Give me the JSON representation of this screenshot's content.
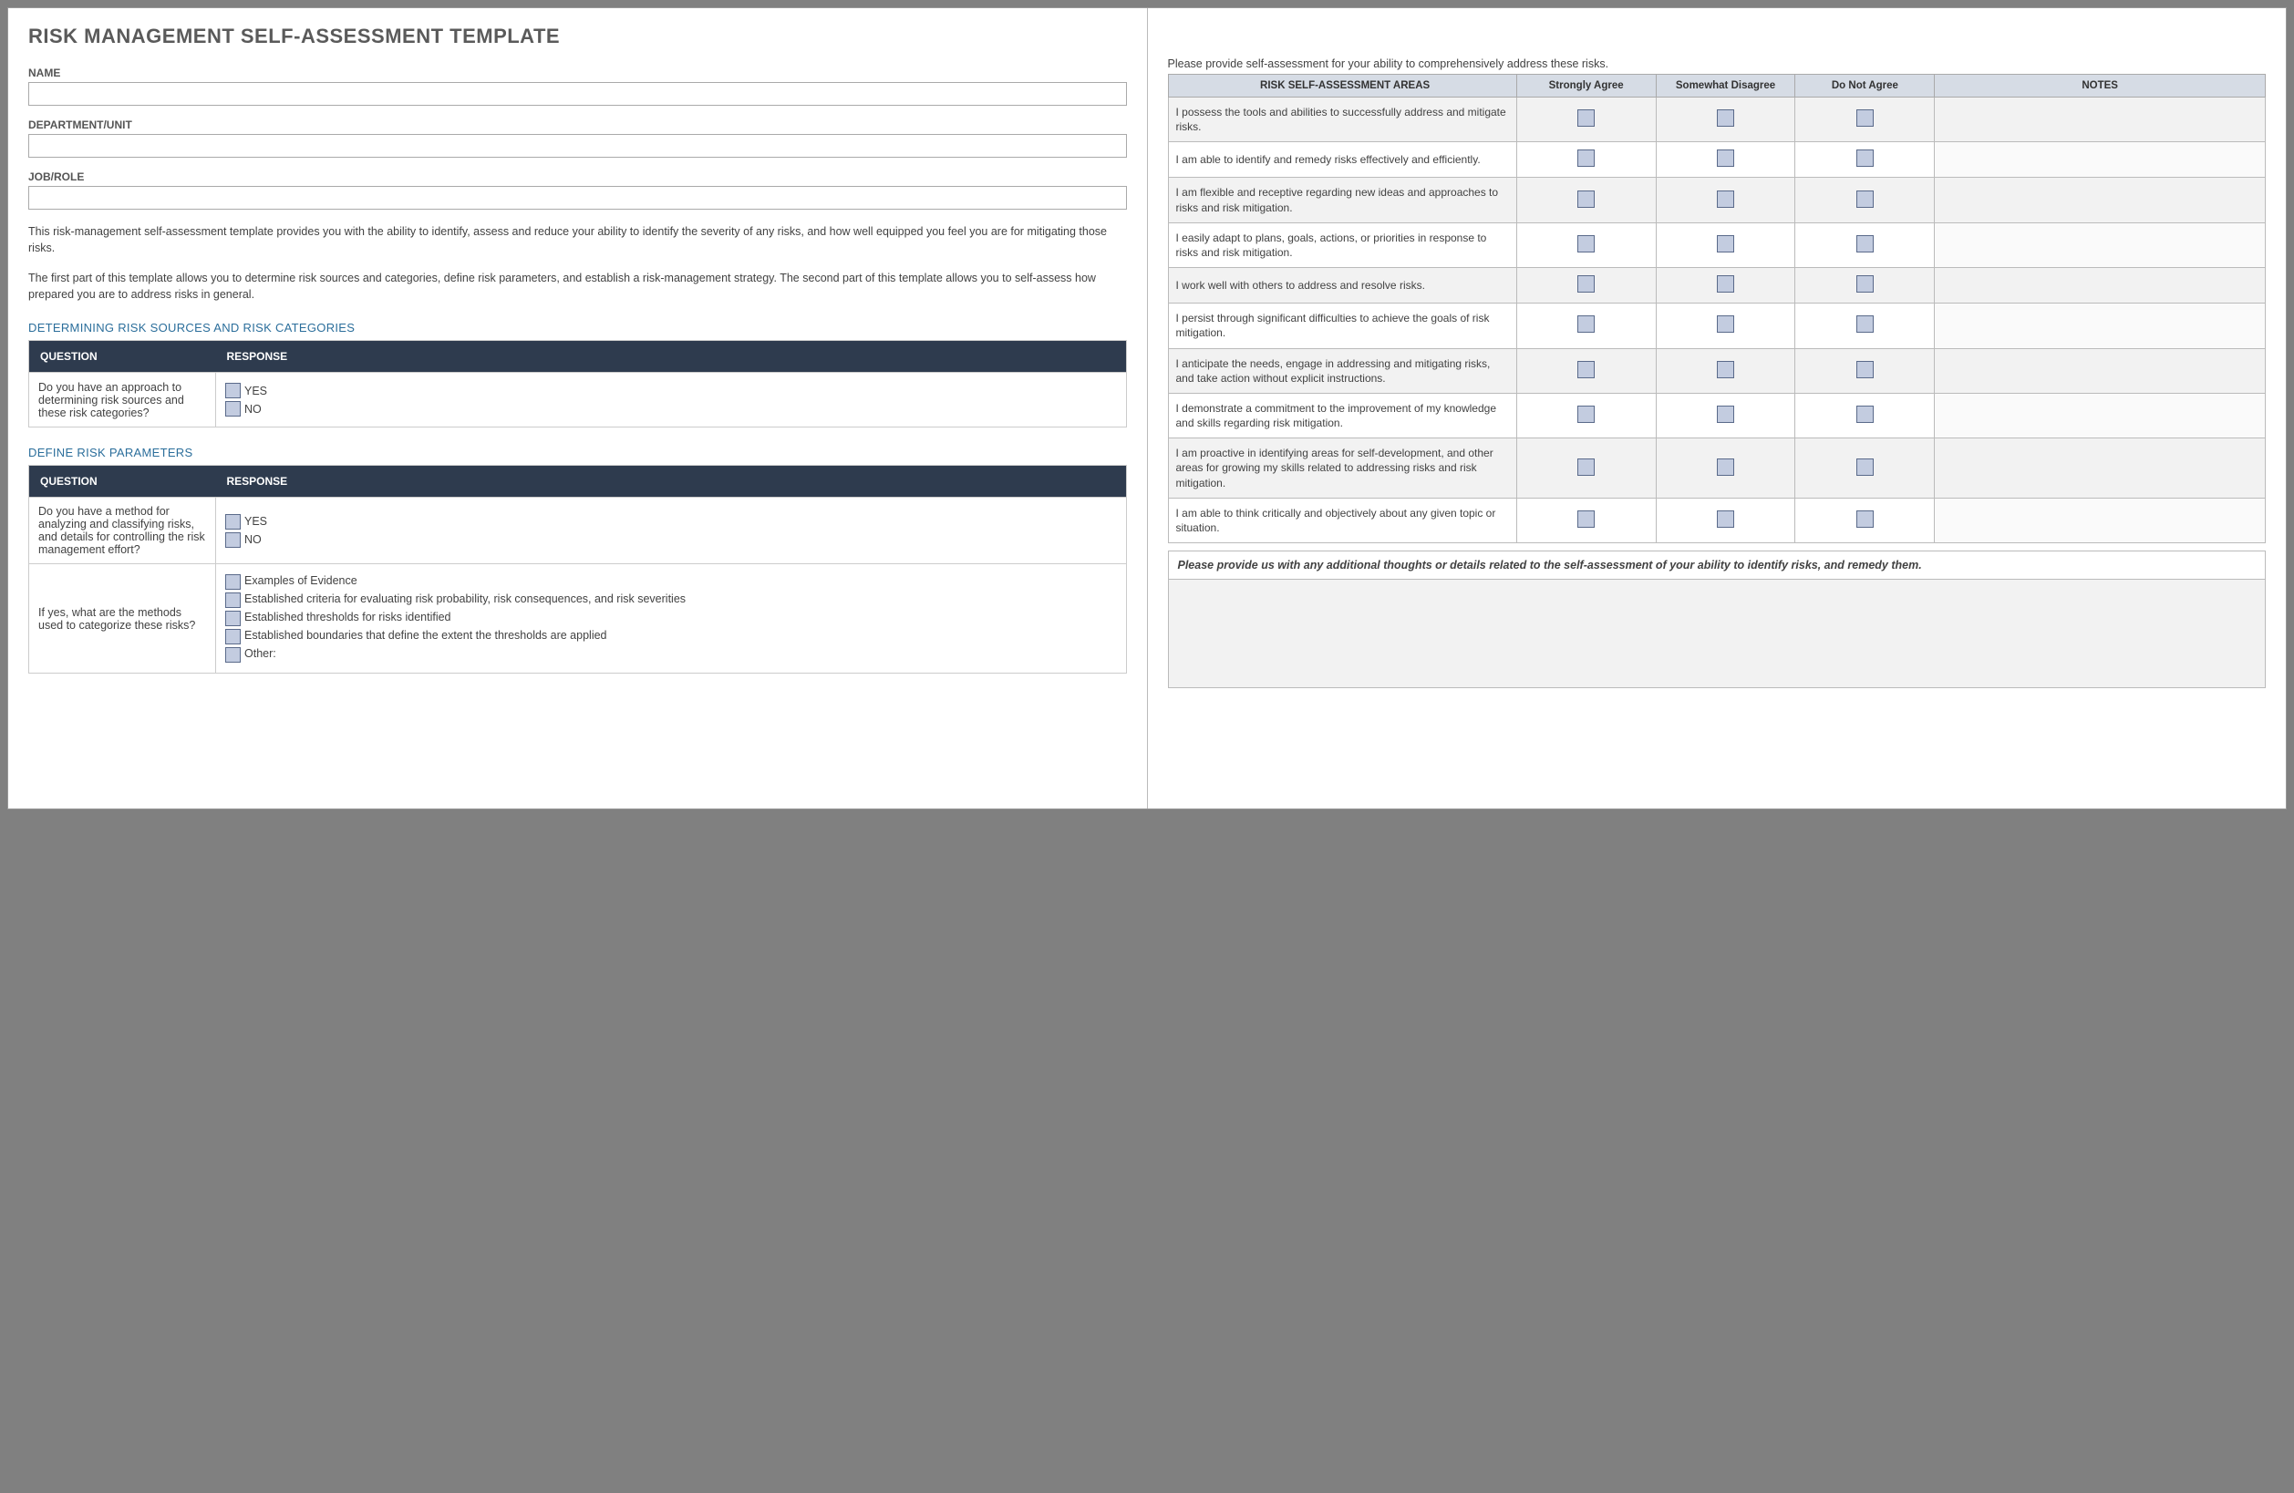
{
  "title": "RISK MANAGEMENT SELF-ASSESSMENT TEMPLATE",
  "fields": {
    "name_label": "NAME",
    "dept_label": "DEPARTMENT/UNIT",
    "job_label": "JOB/ROLE"
  },
  "intro1": "This risk-management self-assessment template provides you with the ability to identify, assess and reduce your ability to identify the severity of any risks, and how well equipped you feel you are for mitigating those risks.",
  "intro2": "The first part of this template allows you to determine risk sources and categories, define risk parameters, and establish a risk-management strategy. The second part of this template allows you to self-assess how prepared you are to address risks in general.",
  "section1_heading": "DETERMINING RISK SOURCES AND RISK CATEGORIES",
  "section2_heading": "DEFINE RISK PARAMETERS",
  "qr_headers": {
    "q": "QUESTION",
    "r": "RESPONSE"
  },
  "yes": "YES",
  "no": "NO",
  "s1_q": "Do you have an approach to determining risk sources and these risk categories?",
  "s2_q1": "Do you have a method for analyzing and classifying risks, and details for controlling the risk management effort?",
  "s2_q2": "If yes, what are the methods used to categorize these risks?",
  "s2_opts": [
    "Examples of Evidence",
    "Established criteria for evaluating risk probability, risk consequences, and risk severities",
    "Established thresholds for risks identified",
    "Established boundaries that define the extent the thresholds are applied",
    "Other:"
  ],
  "right_intro": "Please provide self-assessment for your ability to comprehensively address these risks.",
  "assess_headers": {
    "area": "RISK SELF-ASSESSMENT AREAS",
    "c1": "Strongly Agree",
    "c2": "Somewhat Disagree",
    "c3": "Do Not Agree",
    "notes": "NOTES"
  },
  "assess_rows": [
    "I possess the tools and abilities to successfully address and mitigate risks.",
    "I am able to identify and remedy risks effectively and efficiently.",
    "I am flexible and receptive regarding new ideas and approaches to risks and risk mitigation.",
    "I easily adapt to plans, goals, actions, or priorities in response to risks and risk mitigation.",
    "I work well with others to address and resolve risks.",
    "I persist through significant difficulties to achieve the goals of risk mitigation.",
    "I anticipate the needs, engage in addressing and mitigating risks, and take action without explicit instructions.",
    "I demonstrate a commitment to the improvement of my knowledge and skills regarding risk mitigation.",
    "I am proactive in identifying areas for self-development, and other areas for growing my skills related to addressing risks and risk mitigation.",
    "I am able to think critically and objectively about any given topic or situation."
  ],
  "footer_note": "Please provide us with any additional thoughts or details related to the self-assessment of your ability to identify risks, and remedy them."
}
